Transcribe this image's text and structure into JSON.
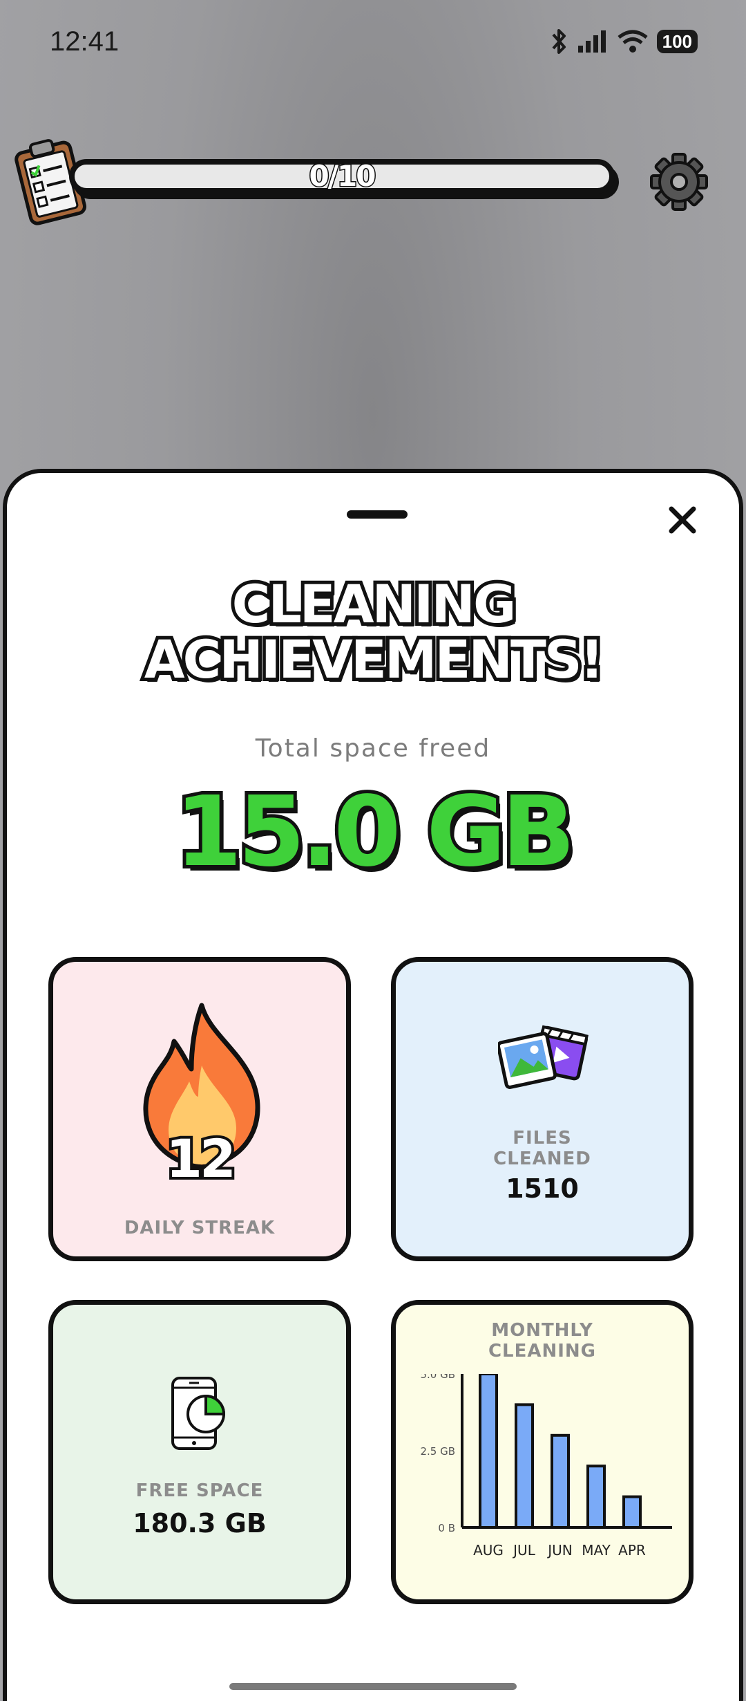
{
  "status_bar": {
    "time": "12:41",
    "battery": "100"
  },
  "progress": {
    "label": "0/10",
    "value_fraction": 0.0
  },
  "sheet": {
    "title_line1": "CLEANING",
    "title_line2": "ACHIEVEMENTS!",
    "subtitle": "Total space freed",
    "total_freed": "15.0 GB"
  },
  "cards": {
    "streak": {
      "number": "12",
      "label": "DAILY STREAK",
      "bg": "#fde9ec"
    },
    "files": {
      "label_line1": "FILES",
      "label_line2": "CLEANED",
      "value": "1510",
      "bg": "#e3f0fb"
    },
    "free": {
      "label": "FREE SPACE",
      "value": "180.3 GB",
      "bg": "#e8f4e8"
    },
    "monthly": {
      "label_line1": "MONTHLY",
      "label_line2": "CLEANING",
      "bg": "#fdfde6"
    }
  },
  "chart_data": {
    "type": "bar",
    "title": "MONTHLY CLEANING",
    "categories": [
      "AUG",
      "JUL",
      "JUN",
      "MAY",
      "APR"
    ],
    "values": [
      5.0,
      4.0,
      3.0,
      2.0,
      1.0
    ],
    "unit": "GB",
    "ylim": [
      0,
      5.0
    ],
    "yticks": [
      "0 B",
      "2.5 GB",
      "5.0 GB"
    ],
    "bar_color": "#7aaaf7"
  },
  "colors": {
    "accent_green": "#3fd13a",
    "outline": "#111111"
  }
}
